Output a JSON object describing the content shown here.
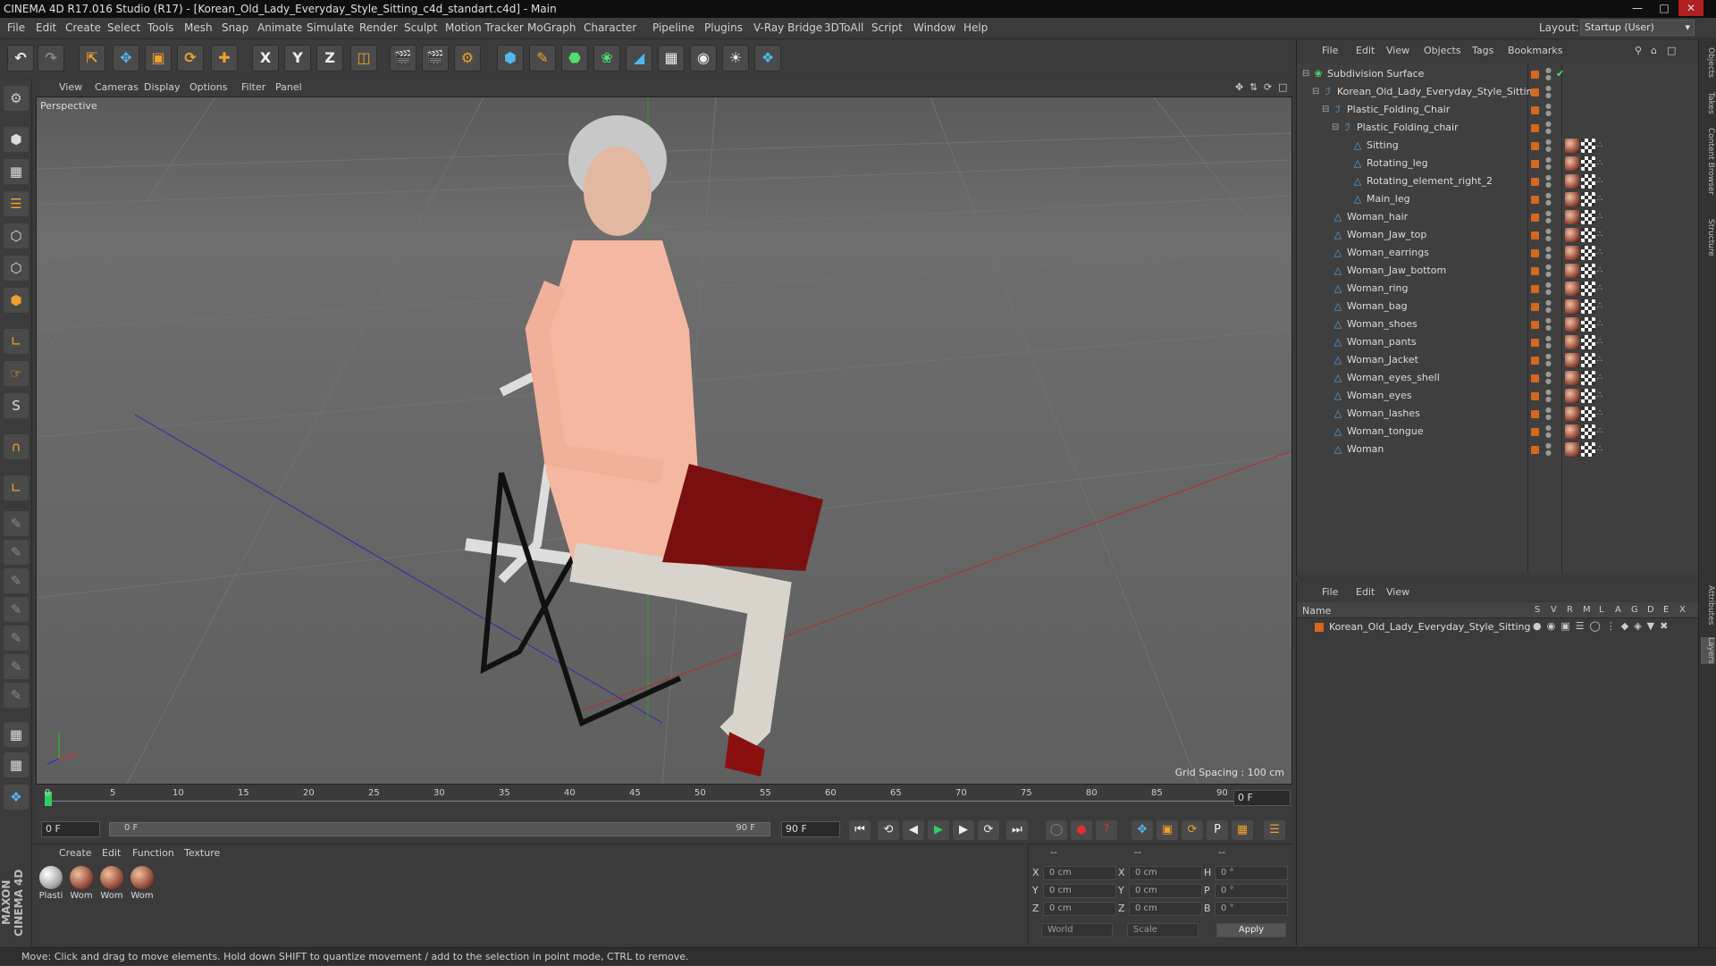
{
  "window": {
    "title": "CINEMA 4D R17.016 Studio (R17) - [Korean_Old_Lady_Everyday_Style_Sitting_c4d_standart.c4d] - Main"
  },
  "menubar": {
    "items": [
      "File",
      "Edit",
      "Create",
      "Select",
      "Tools",
      "Mesh",
      "Snap",
      "Animate",
      "Simulate",
      "Render",
      "Sculpt",
      "Motion Tracker",
      "MoGraph",
      "Character",
      "Pipeline",
      "Plugins",
      "V-Ray Bridge",
      "3DToAll",
      "Script",
      "Window",
      "Help"
    ],
    "layout_label": "Layout:",
    "layout_value": "Startup (User)"
  },
  "viewport": {
    "menu": [
      "View",
      "Cameras",
      "Display",
      "Options",
      "Filter",
      "Panel"
    ],
    "label": "Perspective",
    "grid_spacing": "Grid Spacing : 100 cm"
  },
  "timeline": {
    "ticks": [
      "0",
      "5",
      "10",
      "15",
      "20",
      "25",
      "30",
      "35",
      "40",
      "45",
      "50",
      "55",
      "60",
      "65",
      "70",
      "75",
      "80",
      "85",
      "90"
    ],
    "current_frame": "0 F",
    "start_field": "0 F",
    "range_start": "0 F",
    "range_end": "90 F",
    "end_field": "90 F"
  },
  "material_manager": {
    "menu": [
      "Create",
      "Edit",
      "Function",
      "Texture"
    ],
    "materials": [
      "Plasti",
      "Wom",
      "Wom",
      "Wom"
    ]
  },
  "coordinates": {
    "headers": [
      "--",
      "--",
      "--"
    ],
    "pos": [
      {
        "axis": "X",
        "value": "0 cm"
      },
      {
        "axis": "Y",
        "value": "0 cm"
      },
      {
        "axis": "Z",
        "value": "0 cm"
      }
    ],
    "size": [
      {
        "axis": "X",
        "value": "0 cm"
      },
      {
        "axis": "Y",
        "value": "0 cm"
      },
      {
        "axis": "Z",
        "value": "0 cm"
      }
    ],
    "rot": [
      {
        "axis": "H",
        "value": "0 °"
      },
      {
        "axis": "P",
        "value": "0 °"
      },
      {
        "axis": "B",
        "value": "0 °"
      }
    ],
    "mode1": "World",
    "mode2": "Scale",
    "apply": "Apply"
  },
  "object_manager": {
    "menu": [
      "File",
      "Edit",
      "View",
      "Objects",
      "Tags",
      "Bookmarks"
    ],
    "tree": [
      {
        "name": "Subdivision Surface",
        "indent": 0
      },
      {
        "name": "Korean_Old_Lady_Everyday_Style_Sitting",
        "indent": 1
      },
      {
        "name": "Plastic_Folding_Chair",
        "indent": 2
      },
      {
        "name": "Plastic_Folding_chair",
        "indent": 3
      },
      {
        "name": "Sitting",
        "indent": 4
      },
      {
        "name": "Rotating_leg",
        "indent": 4
      },
      {
        "name": "Rotating_element_right_2",
        "indent": 4
      },
      {
        "name": "Main_leg",
        "indent": 4
      },
      {
        "name": "Woman_hair",
        "indent": 2
      },
      {
        "name": "Woman_Jaw_top",
        "indent": 2
      },
      {
        "name": "Woman_earrings",
        "indent": 2
      },
      {
        "name": "Woman_Jaw_bottom",
        "indent": 2
      },
      {
        "name": "Woman_ring",
        "indent": 2
      },
      {
        "name": "Woman_bag",
        "indent": 2
      },
      {
        "name": "Woman_shoes",
        "indent": 2
      },
      {
        "name": "Woman_pants",
        "indent": 2
      },
      {
        "name": "Woman_Jacket",
        "indent": 2
      },
      {
        "name": "Woman_eyes_shell",
        "indent": 2
      },
      {
        "name": "Woman_eyes",
        "indent": 2
      },
      {
        "name": "Woman_lashes",
        "indent": 2
      },
      {
        "name": "Woman_tongue",
        "indent": 2
      },
      {
        "name": "Woman",
        "indent": 2
      }
    ]
  },
  "layer_manager": {
    "menu": [
      "File",
      "Edit",
      "View"
    ],
    "name_header": "Name",
    "columns": [
      "S",
      "V",
      "R",
      "M",
      "L",
      "A",
      "G",
      "D",
      "E",
      "X"
    ],
    "layers": [
      "Korean_Old_Lady_Everyday_Style_Sitting"
    ]
  },
  "right_tabs": [
    "Objects",
    "Takes",
    "Content Browser",
    "Structure",
    "Attributes",
    "Layers"
  ],
  "logo": "MAXON CINEMA 4D",
  "status": "Move: Click and drag to move elements. Hold down SHIFT to quantize movement / add to the selection in point mode, CTRL to remove."
}
